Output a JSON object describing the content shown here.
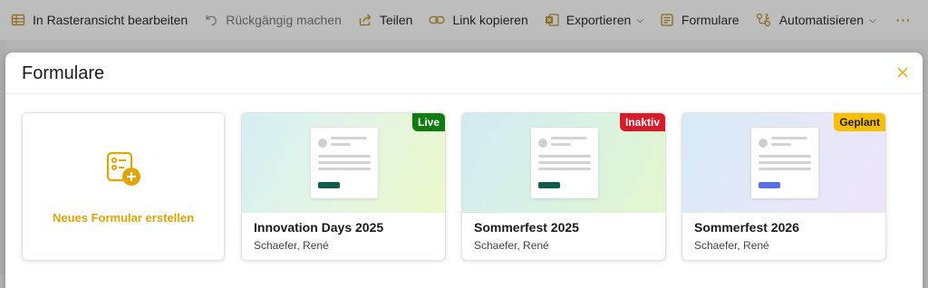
{
  "toolbar": {
    "items": [
      {
        "label": "In Rasteransicht bearbeiten",
        "icon": "grid-icon",
        "disabled": false
      },
      {
        "label": "Rückgängig machen",
        "icon": "undo-icon",
        "disabled": true
      },
      {
        "label": "Teilen",
        "icon": "share-icon",
        "disabled": false
      },
      {
        "label": "Link kopieren",
        "icon": "link-icon",
        "disabled": false
      },
      {
        "label": "Exportieren",
        "icon": "excel-icon",
        "disabled": false
      },
      {
        "label": "Formulare",
        "icon": "form-icon",
        "disabled": false
      },
      {
        "label": "Automatisieren",
        "icon": "automate-icon",
        "disabled": false
      }
    ],
    "more": "···"
  },
  "modal": {
    "title": "Formulare",
    "new_form_label": "Neues Formular erstellen",
    "forms": [
      {
        "title": "Innovation Days 2025",
        "owner": "Schaefer, René",
        "status": "Live",
        "status_color": "#107c10",
        "button_color": "#0e5c4a"
      },
      {
        "title": "Sommerfest 2025",
        "owner": "Schaefer, René",
        "status": "Inaktiv",
        "status_color": "#d91a2a",
        "button_color": "#0e5c4a"
      },
      {
        "title": "Sommerfest 2026",
        "owner": "Schaefer, René",
        "status": "Geplant",
        "status_color": "#f6c000",
        "button_color": "#5b6ee8"
      }
    ]
  },
  "colors": {
    "accent": "#e3a300"
  }
}
